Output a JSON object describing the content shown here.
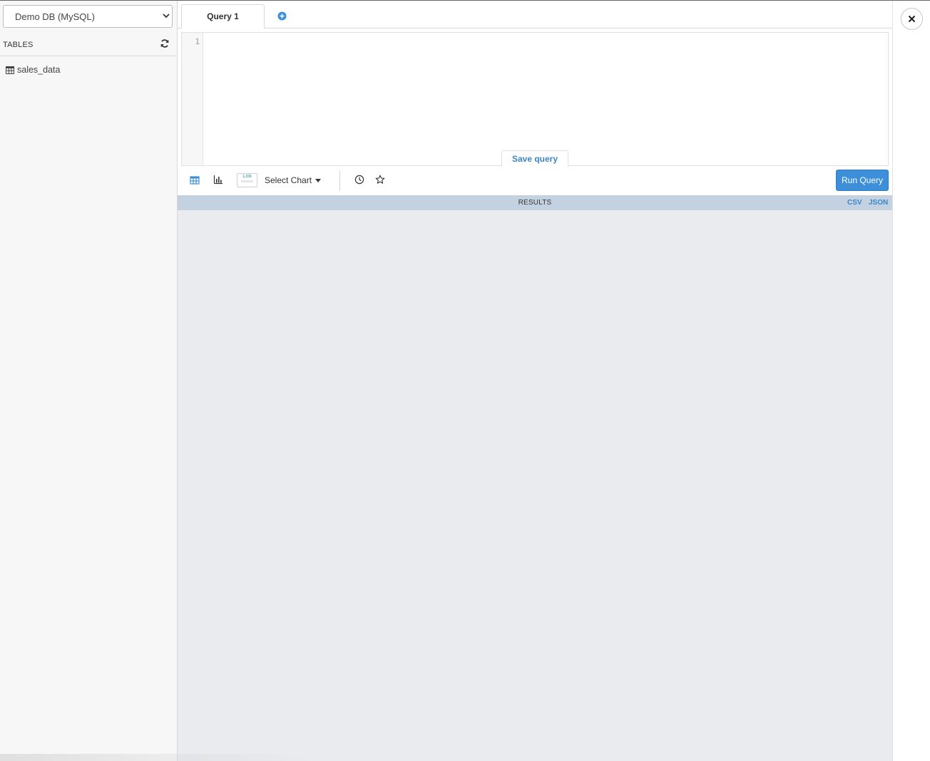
{
  "datasource": {
    "selected": "Demo DB (MySQL)"
  },
  "sidebar": {
    "tables_title": "TABLES",
    "refresh_icon": "refresh-icon",
    "tables": [
      {
        "label": "sales_data",
        "icon": "table-icon"
      }
    ]
  },
  "tabs": [
    {
      "label": "Query 1"
    }
  ],
  "add_tab_icon": "plus-circle-icon",
  "editor": {
    "line_numbers": [
      "1"
    ],
    "content": "",
    "save_label": "Save query"
  },
  "toolbar": {
    "table_view_icon": "table-view-icon",
    "chart_view_icon": "bar-chart-icon",
    "chart_thumbnail_text": "1,336",
    "select_chart_label": "Select Chart",
    "history_icon": "clock-icon",
    "favorite_icon": "star-icon",
    "run_label": "Run Query"
  },
  "results": {
    "title": "RESULTS",
    "csv_label": "CSV",
    "json_label": "JSON"
  },
  "close_icon": "close-icon",
  "colors": {
    "accent": "#3d8fd9",
    "link": "#3a87c8",
    "results_bar": "#c3d1e0",
    "results_bg": "#e9ebee"
  }
}
